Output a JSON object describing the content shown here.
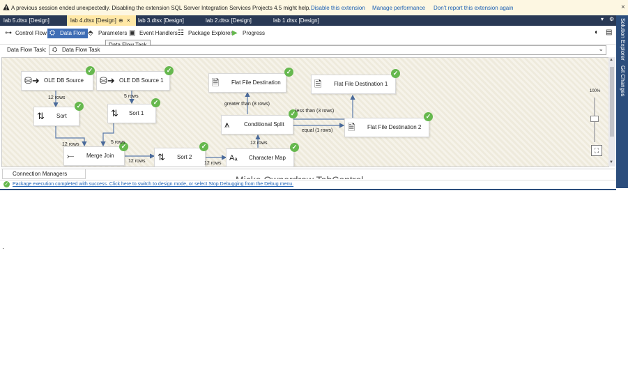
{
  "infobar": {
    "message": "A previous session ended unexpectedly. Disabling the extension SQL Server Integration Services Projects 4.5 might help.",
    "links": [
      "Disable this extension",
      "Manage performance",
      "Don't report this extension again"
    ],
    "close": "×"
  },
  "tabs": [
    {
      "label": "lab 5.dtsx [Design]",
      "active": false
    },
    {
      "label": "lab 4.dtsx [Design]",
      "active": true
    },
    {
      "label": "lab 3.dtsx [Design]",
      "active": false
    },
    {
      "label": "lab 2.dtsx [Design]",
      "active": false
    },
    {
      "label": "lab 1.dtsx [Design]",
      "active": false
    }
  ],
  "tab_icons": {
    "pin": "⊕",
    "close": "×"
  },
  "sidebar": {
    "items": [
      "Solution Explorer",
      "Git Changes"
    ]
  },
  "toolbar": {
    "items": [
      "Control Flow",
      "Data Flow",
      "Parameters",
      "Event Handlers",
      "Package Explorer",
      "Progress"
    ],
    "active": "Data Flow"
  },
  "tooltip": "Data Flow Task",
  "task": {
    "label": "Data Flow Task:",
    "value": "Data Flow Task"
  },
  "components": {
    "ole_source": "OLE DB Source",
    "ole_source_1": "OLE DB Source 1",
    "sort": "Sort",
    "sort_1": "Sort 1",
    "merge_join": "Merge Join",
    "sort_2": "Sort 2",
    "character_map": "Character Map",
    "conditional_split": "Conditional Split",
    "flat_dest": "Flat File Destination",
    "flat_dest_1": "Flat File Destination 1",
    "flat_dest_2": "Flat File Destination 2"
  },
  "flows": {
    "src_to_sort": "12 rows",
    "src1_to_sort1": "5 rows",
    "sort_to_merge": "12 rows",
    "sort1_to_merge": "5 rows",
    "merge_to_sort2": "12 rows",
    "sort2_to_charmap": "12 rows",
    "charmap_to_split": "12 rows",
    "split_greater": "greater than (8 rows)",
    "split_less": "less than (3 rows)",
    "split_equal": "equal (1 rows)"
  },
  "zoom": {
    "percent": "100%"
  },
  "connection_managers": "Connection Managers",
  "overlay_text": "Micke Ownerdraw TabControl",
  "status": "Package execution completed with success. Click here to switch to design mode, or select Stop Debugging from the Debug menu."
}
